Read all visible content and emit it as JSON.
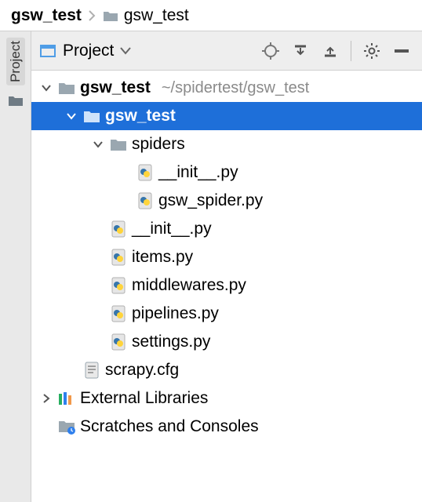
{
  "breadcrumb": {
    "root": "gsw_test",
    "child": "gsw_test"
  },
  "toolstrip": {
    "tab_label": "Project"
  },
  "panel": {
    "title": "Project"
  },
  "tree": {
    "project": {
      "name": "gsw_test",
      "path": "~/spidertest/gsw_test"
    },
    "pkg": {
      "name": "gsw_test"
    },
    "spiders": {
      "name": "spiders",
      "files": {
        "init": "__init__.py",
        "spider": "gsw_spider.py"
      }
    },
    "pkg_files": {
      "init": "__init__.py",
      "items": "items.py",
      "middlewares": "middlewares.py",
      "pipelines": "pipelines.py",
      "settings": "settings.py"
    },
    "cfg": "scrapy.cfg",
    "ext_lib": "External Libraries",
    "scratches": "Scratches and Consoles"
  }
}
